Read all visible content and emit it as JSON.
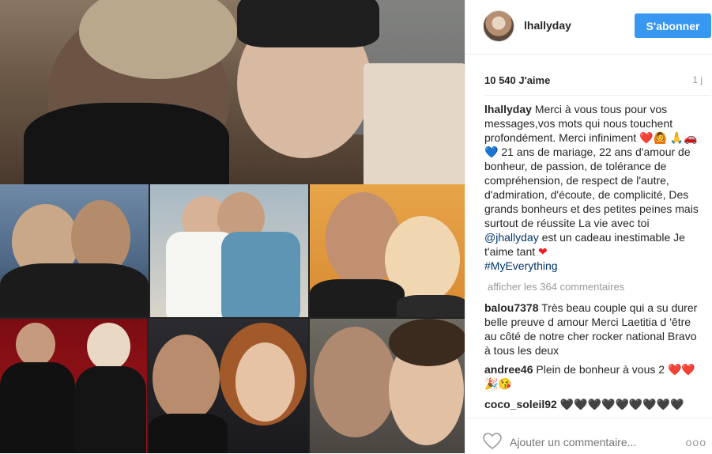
{
  "post": {
    "username": "lhallyday",
    "follow_label": "S'abonner",
    "likes": "10 540 J'aime",
    "time": "1 j",
    "caption": {
      "username": "lhallyday",
      "part1": "Merci à vous tous pour vos messages,vos mots qui nous touchent profondément. Merci infiniment",
      "emoji1": "❤️🙆",
      "emoji2": "🙏🚗💙",
      "part2": "21 ans de mariage, 22 ans d'amour de bonheur, de passion, de tolérance de compréhension, de respect de l'autre, d'admiration, d'écoute, de complicité, Des grands bonheurs et des petites peines mais surtout de réussite La vie avec toi",
      "mention": "@jhallyday",
      "part3": "est un cadeau inestimable Je t'aime tant",
      "heart": "❤",
      "hashtag": "#MyEverything"
    },
    "more_comments": "afficher les 364 commentaires",
    "comments": [
      {
        "user": "balou7378",
        "text": "Très beau couple qui a su durer belle preuve d amour Merci Laetitia d 'être au côté de notre cher rocker national Bravo à tous les deux"
      },
      {
        "user": "andree46",
        "text": "Plein de bonheur à vous 2",
        "emoji": "❤️❤️🎉😘"
      },
      {
        "user": "coco_soleil92",
        "text": "🖤🖤🖤🖤🖤🖤🖤🖤🖤"
      }
    ],
    "add_comment_placeholder": "Ajouter un commentaire...",
    "more_options": "ooo"
  },
  "icons": {
    "like": "heart-outline-icon",
    "options": "more-options-icon"
  },
  "colors": {
    "accent": "#3897f0",
    "link": "#003569",
    "muted": "#999999",
    "heart": "#ed1c24"
  }
}
